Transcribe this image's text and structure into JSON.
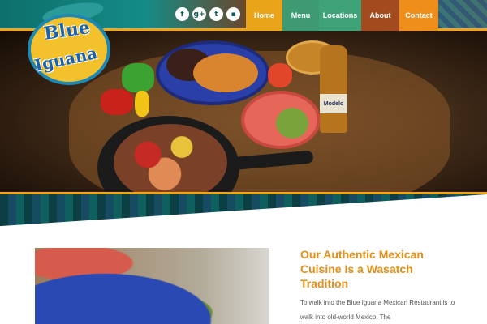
{
  "header": {
    "social": [
      {
        "icon": "facebook-icon",
        "glyph": "f"
      },
      {
        "icon": "google-plus-icon",
        "glyph": "g+"
      },
      {
        "icon": "twitter-icon",
        "glyph": "t"
      },
      {
        "icon": "chat-icon",
        "glyph": "▪"
      }
    ],
    "nav": [
      "Home",
      "Menu",
      "Locations",
      "About",
      "Contact"
    ]
  },
  "logo": {
    "line1": "Blue",
    "line2": "Iguana"
  },
  "hero": {
    "bottle_label": "Modelo"
  },
  "content": {
    "heading": "Our Authentic Mexican Cuisine Is a Wasatch Tradition",
    "body": "To walk into the Blue Iguana Mexican Restaurant is to walk into old-world Mexico. The"
  },
  "colors": {
    "accent": "#e38f1a",
    "nav_home": "#e9a419",
    "nav_green": "#3d9a73",
    "nav_about": "#a34b1e",
    "nav_contact": "#ef8e1a"
  }
}
